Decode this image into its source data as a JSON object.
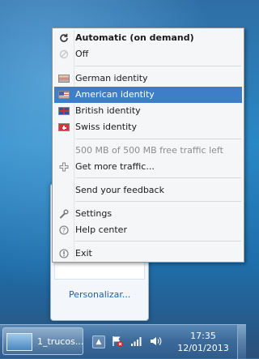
{
  "menu": {
    "items": [
      {
        "label": "Automatic (on demand)",
        "icon": "refresh-icon"
      },
      {
        "label": "Off",
        "icon": "off-icon"
      },
      {
        "label": "German identity",
        "icon": "german-flag-icon"
      },
      {
        "label": "American identity",
        "icon": "us-flag-icon",
        "highlighted": true
      },
      {
        "label": "British identity",
        "icon": "uk-flag-icon"
      },
      {
        "label": "Swiss identity",
        "icon": "swiss-flag-icon"
      },
      {
        "label": "500 MB of 500 MB free traffic left",
        "disabled": true
      },
      {
        "label": "Get more traffic...",
        "icon": "plus-icon"
      },
      {
        "label": "Send your feedback"
      },
      {
        "label": "Settings",
        "icon": "wrench-icon"
      },
      {
        "label": "Help center",
        "icon": "help-icon"
      },
      {
        "label": "Exit",
        "icon": "exit-icon"
      }
    ]
  },
  "tray_popup": {
    "customize_label": "Personalizar..."
  },
  "taskbar": {
    "window_label": "1_trucos...",
    "time": "17:35",
    "date": "12/01/2013",
    "highlight_color": "#3d7fc7"
  }
}
